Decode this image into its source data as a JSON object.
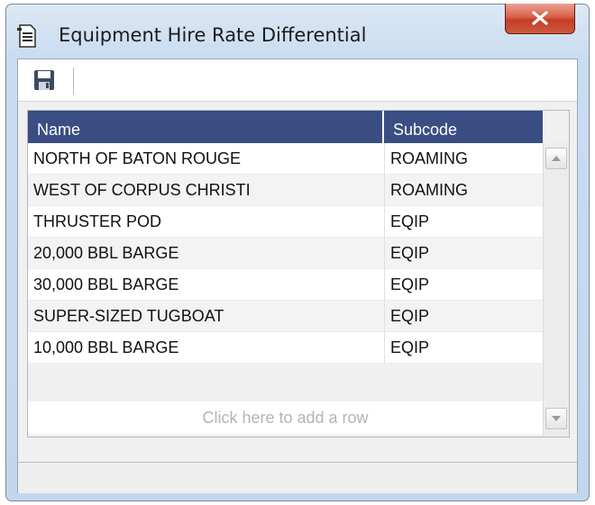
{
  "window": {
    "title": "Equipment Hire Rate Differential",
    "icons": {
      "app": "document-list-icon",
      "close": "close-icon",
      "save": "save-icon"
    }
  },
  "grid": {
    "columns": [
      "Name",
      "Subcode"
    ],
    "rows": [
      {
        "name": "NORTH OF BATON ROUGE",
        "subcode": "ROAMING"
      },
      {
        "name": "WEST OF CORPUS CHRISTI",
        "subcode": "ROAMING"
      },
      {
        "name": "THRUSTER POD",
        "subcode": "EQIP"
      },
      {
        "name": "20,000 BBL BARGE",
        "subcode": "EQIP"
      },
      {
        "name": "30,000 BBL BARGE",
        "subcode": "EQIP"
      },
      {
        "name": "SUPER-SIZED TUGBOAT",
        "subcode": "EQIP"
      },
      {
        "name": "10,000 BBL BARGE",
        "subcode": "EQIP"
      }
    ],
    "add_row_text": "Click here to add a row"
  },
  "colors": {
    "header_bg": "#3a4e83",
    "close_button": "#c43e25"
  }
}
